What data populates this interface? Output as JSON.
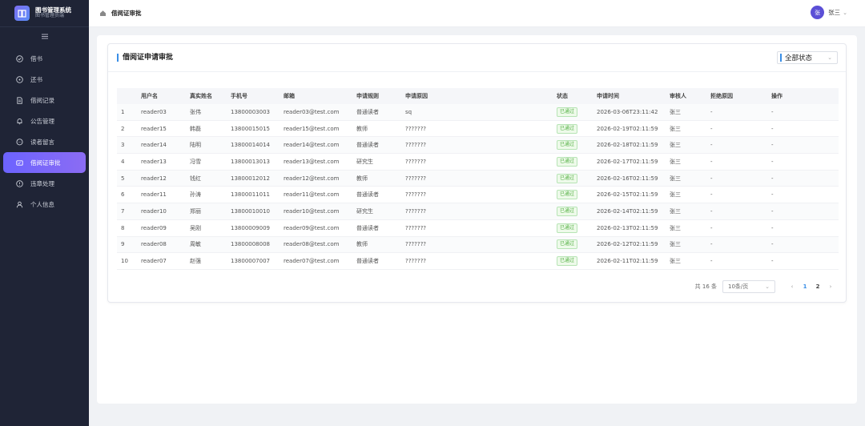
{
  "brand": {
    "title": "图书管理系统",
    "subtitle": "图书管理员端"
  },
  "sidebar": {
    "items": [
      {
        "label": "借书",
        "icon": "check-circle-icon"
      },
      {
        "label": "还书",
        "icon": "plus-circle-icon"
      },
      {
        "label": "借阅记录",
        "icon": "document-icon"
      },
      {
        "label": "公告管理",
        "icon": "bell-icon"
      },
      {
        "label": "读者留言",
        "icon": "chat-icon"
      },
      {
        "label": "借阅证审批",
        "icon": "id-card-icon",
        "active": true
      },
      {
        "label": "违章处理",
        "icon": "warning-icon"
      },
      {
        "label": "个人信息",
        "icon": "user-icon"
      }
    ]
  },
  "header": {
    "breadcrumb": "借阅证审批",
    "user_avatar": "张",
    "user_name": "张三"
  },
  "card": {
    "title": "借阅证申请审批",
    "status_filter": "全部状态"
  },
  "table": {
    "columns": [
      "",
      "用户名",
      "真实姓名",
      "手机号",
      "邮箱",
      "申请规则",
      "申请原因",
      "状态",
      "申请时间",
      "审核人",
      "拒绝原因",
      "操作"
    ],
    "rows": [
      [
        "1",
        "reader03",
        "张伟",
        "13800003003",
        "reader03@test.com",
        "普通读者",
        "sq",
        "已通过",
        "2026-03-06T23:11:42",
        "张三",
        "-",
        "-"
      ],
      [
        "2",
        "reader15",
        "韩磊",
        "13800015015",
        "reader15@test.com",
        "教师",
        "???????",
        "已通过",
        "2026-02-19T02:11:59",
        "张三",
        "-",
        "-"
      ],
      [
        "3",
        "reader14",
        "陆明",
        "13800014014",
        "reader14@test.com",
        "普通读者",
        "???????",
        "已通过",
        "2026-02-18T02:11:59",
        "张三",
        "-",
        "-"
      ],
      [
        "4",
        "reader13",
        "冯雪",
        "13800013013",
        "reader13@test.com",
        "研究生",
        "???????",
        "已通过",
        "2026-02-17T02:11:59",
        "张三",
        "-",
        "-"
      ],
      [
        "5",
        "reader12",
        "钱红",
        "13800012012",
        "reader12@test.com",
        "教师",
        "???????",
        "已通过",
        "2026-02-16T02:11:59",
        "张三",
        "-",
        "-"
      ],
      [
        "6",
        "reader11",
        "孙涛",
        "13800011011",
        "reader11@test.com",
        "普通读者",
        "???????",
        "已通过",
        "2026-02-15T02:11:59",
        "张三",
        "-",
        "-"
      ],
      [
        "7",
        "reader10",
        "郑丽",
        "13800010010",
        "reader10@test.com",
        "研究生",
        "???????",
        "已通过",
        "2026-02-14T02:11:59",
        "张三",
        "-",
        "-"
      ],
      [
        "8",
        "reader09",
        "吴刚",
        "13800009009",
        "reader09@test.com",
        "普通读者",
        "???????",
        "已通过",
        "2026-02-13T02:11:59",
        "张三",
        "-",
        "-"
      ],
      [
        "9",
        "reader08",
        "周敏",
        "13800008008",
        "reader08@test.com",
        "教师",
        "???????",
        "已通过",
        "2026-02-12T02:11:59",
        "张三",
        "-",
        "-"
      ],
      [
        "10",
        "reader07",
        "赵强",
        "13800007007",
        "reader07@test.com",
        "普通读者",
        "???????",
        "已通过",
        "2026-02-11T02:11:59",
        "张三",
        "-",
        "-"
      ]
    ]
  },
  "pagination": {
    "total_text": "共 16 条",
    "page_size": "10条/页",
    "pages": [
      "1",
      "2"
    ],
    "current": "1"
  },
  "colors": {
    "accent": "#6c63ff",
    "sidebar_bg": "#1f2436",
    "success": "#52b043",
    "link": "#3a8ee6"
  }
}
